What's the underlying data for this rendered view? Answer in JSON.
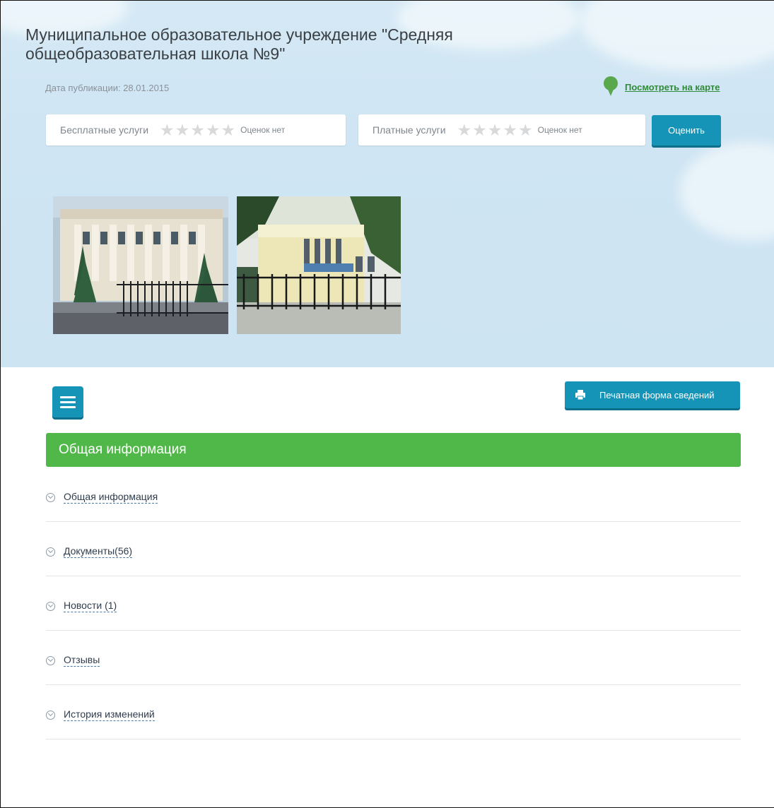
{
  "header": {
    "title": "Муниципальное образовательное учреждение \"Средняя общеобразовательная школа №9\"",
    "pub_date": "Дата публикации: 28.01.2015",
    "map_link": "Посмотреть на карте"
  },
  "ratings": {
    "free": {
      "label": "Бесплатные услуги",
      "status": "Оценок нет",
      "stars": 5
    },
    "paid": {
      "label": "Платные услуги",
      "status": "Оценок нет",
      "stars": 5
    },
    "rate_button": "Оценить"
  },
  "toolbar": {
    "print_button": "Печатная форма сведений"
  },
  "section": {
    "title": "Общая информация",
    "items": [
      {
        "label": "Общая информация"
      },
      {
        "label": "Документы(56)"
      },
      {
        "label": "Новости (1)"
      },
      {
        "label": "Отзывы"
      },
      {
        "label": "История изменений"
      }
    ]
  },
  "icons": {
    "map_pin": "map-pin-icon",
    "star": "star-icon",
    "menu": "hamburger-menu-icon",
    "print": "printer-icon",
    "expand": "chevron-circle-down-icon"
  },
  "colors": {
    "accent": "#1694b8",
    "section_green": "#50b848",
    "link_green": "#2f8a3a",
    "hero_bg": "#d5e9f5"
  }
}
